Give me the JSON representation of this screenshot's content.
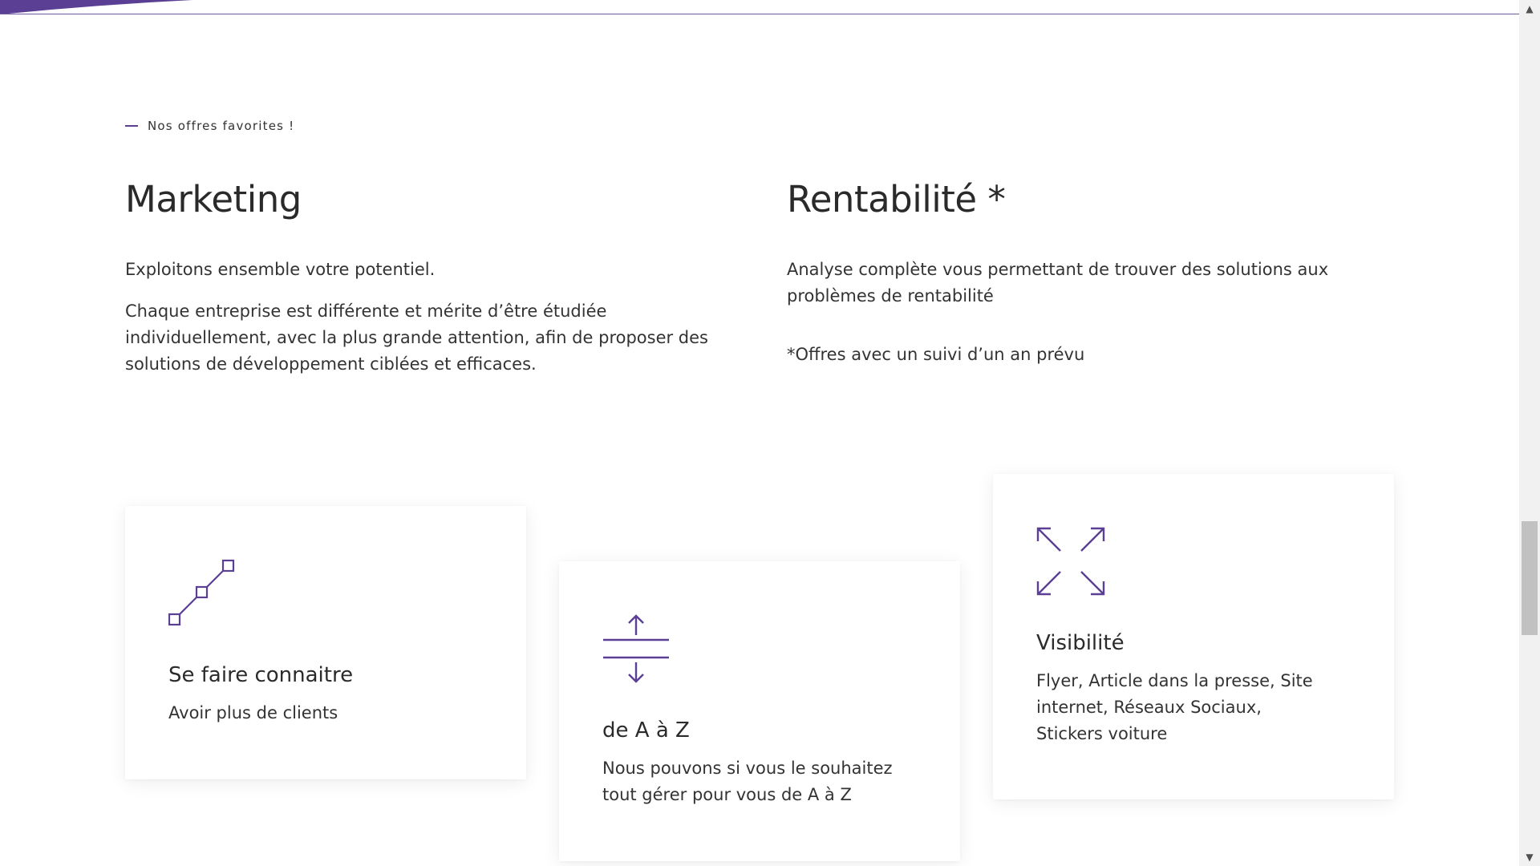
{
  "eyebrow": "Nos offres favorites !",
  "marketing": {
    "title": "Marketing",
    "intro": "Exploitons ensemble votre potentiel.",
    "body": "Chaque entreprise est différente et mérite d’être étudiée individuellement, avec la plus grande attention, afin de proposer des solutions de développement ciblées et efficaces."
  },
  "rentabilite": {
    "title": "Rentabilité *",
    "body": "Analyse complète vous permettant de trouver des solutions aux problèmes de rentabilité",
    "note": "*Offres avec un suivi d’un an prévu"
  },
  "cards": [
    {
      "icon": "line-nodes-icon",
      "title": "Se faire connaitre",
      "text": "Avoir plus de clients"
    },
    {
      "icon": "split-arrows-icon",
      "title": "de A à Z",
      "text": "Nous pouvons si vous le souhaitez tout gérer pour vous de A à Z"
    },
    {
      "icon": "expand-icon",
      "title": "Visibilité",
      "text": "Flyer, Article dans la presse, Site internet, Réseaux Sociaux, Stickers voiture"
    }
  ],
  "colors": {
    "accent": "#5b3f95",
    "text": "#2b2b2b",
    "background": "#ffffff"
  }
}
